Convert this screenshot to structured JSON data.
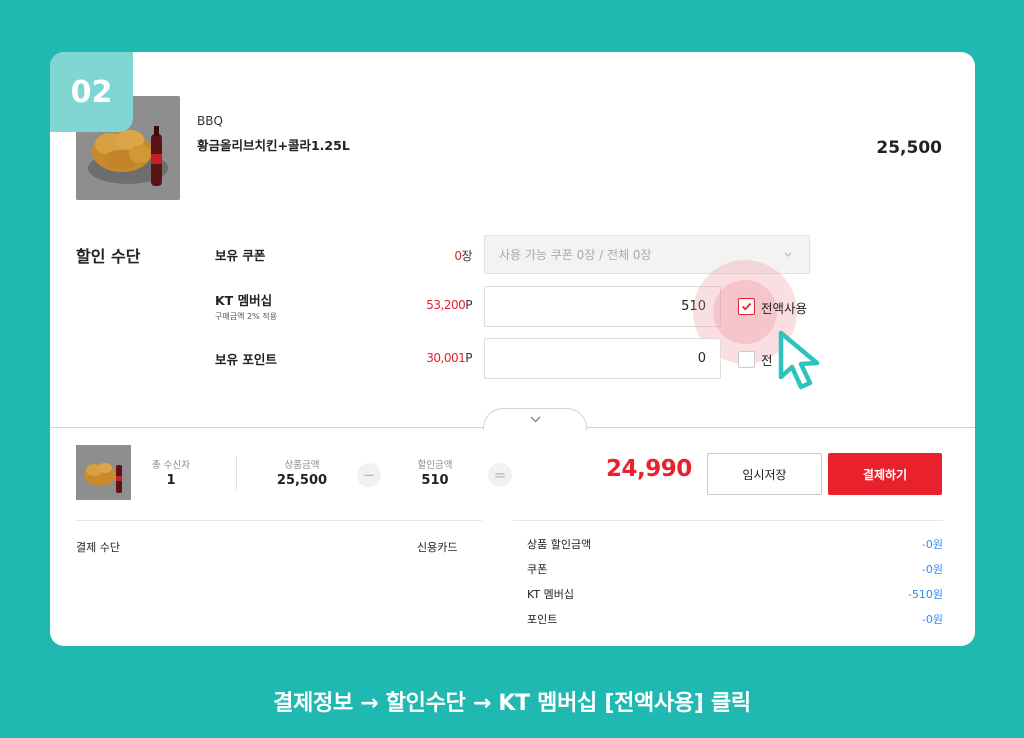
{
  "step_badge": "02",
  "product": {
    "brand": "BBQ",
    "name": "황금올리브치킨+콜라1.25L",
    "price": "25,500"
  },
  "discount": {
    "title": "할인 수단",
    "coupon": {
      "label": "보유 쿠폰",
      "amount": "0",
      "unit": "장",
      "select_value": "사용 가능 쿠폰 0장 / 전체 0장"
    },
    "membership": {
      "label": "KT 멤버십",
      "sub": "구매금액 2% 적용",
      "amount": "53,200",
      "unit": "P",
      "input_value": "510",
      "use_all_label": "전액사용",
      "use_all_checked": true
    },
    "points": {
      "label": "보유 포인트",
      "amount": "30,001",
      "unit": "P",
      "input_value": "0",
      "use_all_label": "전",
      "use_all_checked": false
    }
  },
  "summary": {
    "recipients_label": "총 수신자",
    "recipients_value": "1",
    "product_amount_label": "상품금액",
    "product_amount_value": "25,500",
    "minus": "−",
    "discount_label": "할인금액",
    "discount_value": "510",
    "equals": "=",
    "total": "24,990",
    "save_button": "임시저장",
    "pay_button": "결제하기"
  },
  "payment": {
    "method_label": "결제 수단",
    "method_value": "신용카드"
  },
  "discount_breakdown": [
    {
      "label": "상품 할인금액",
      "value": "-0원"
    },
    {
      "label": "쿠폰",
      "value": "-0원"
    },
    {
      "label": "KT 멤버십",
      "value": "-510원"
    },
    {
      "label": "포인트",
      "value": "-0원"
    }
  ],
  "caption": "결제정보 → 할인수단 → KT 멤버십 [전액사용] 클릭",
  "colors": {
    "background": "#20b9b1",
    "badge": "#7fd6d2",
    "accent_red": "#e8212c",
    "discount_blue": "#2f8cf4",
    "cursor": "#2fc3c0"
  },
  "icons": {
    "dropdown": "chevron-down-icon",
    "check": "check-icon",
    "cursor": "mouse-pointer-icon",
    "collapse": "chevron-down-icon"
  }
}
